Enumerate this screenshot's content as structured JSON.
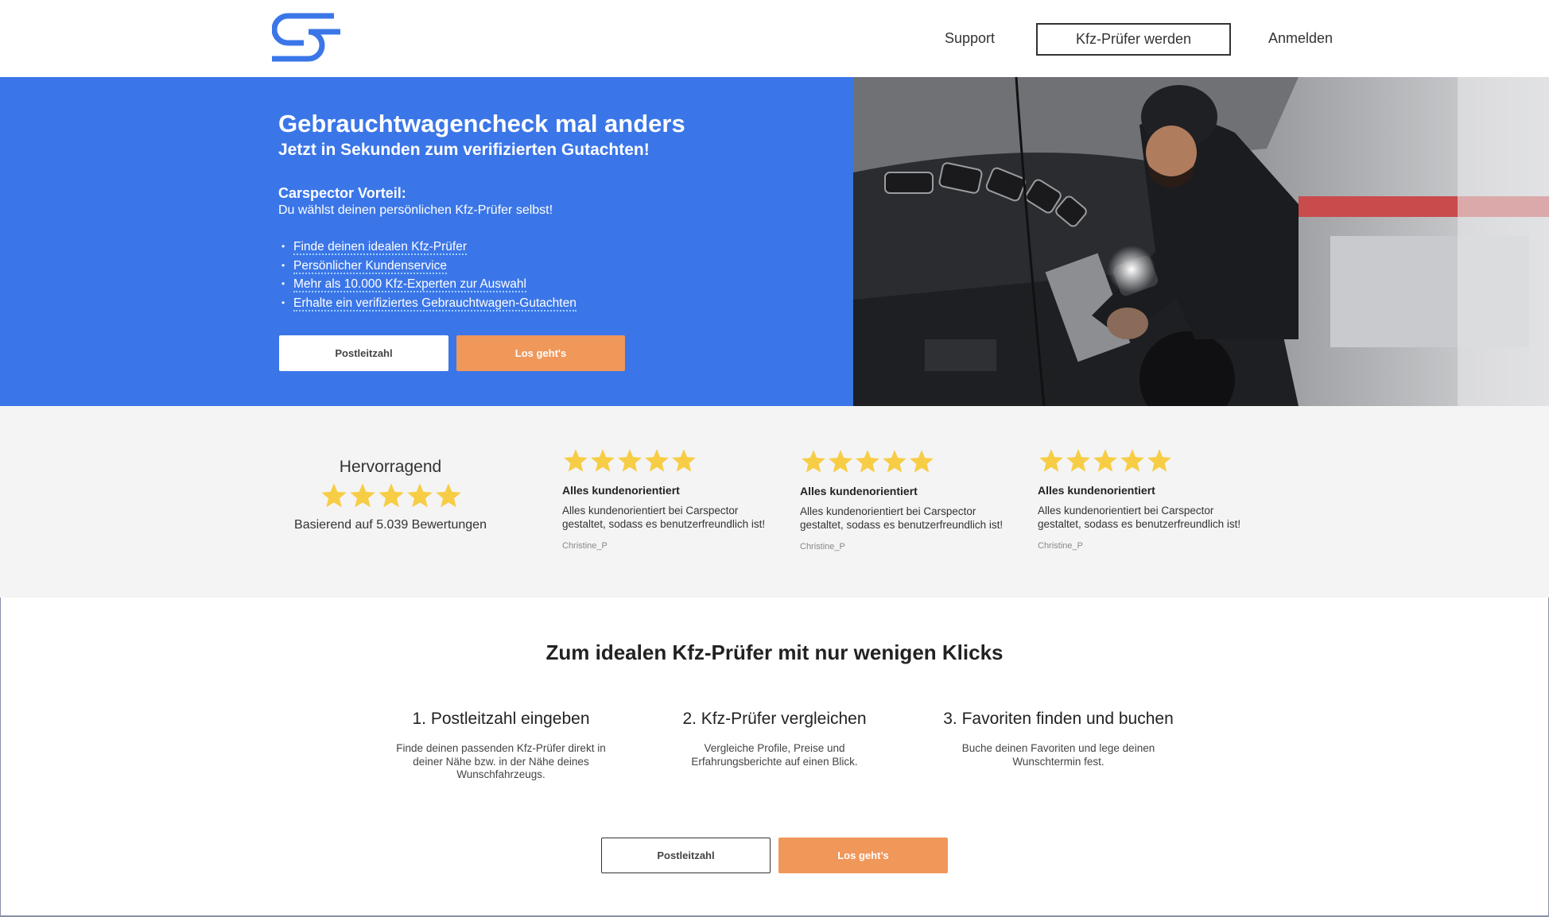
{
  "header": {
    "nav": {
      "support": "Support",
      "become_inspector": "Kfz-Prüfer werden",
      "login": "Anmelden"
    }
  },
  "hero": {
    "title": "Gebrauchtwagencheck mal anders",
    "subtitle": "Jetzt in Sekunden zum verifizierten Gutachten!",
    "advantage_heading": "Carspector Vorteil:",
    "advantage_text": "Du wählst deinen persönlichen Kfz-Prüfer selbst!",
    "bullets": [
      "Finde deinen idealen Kfz-Prüfer",
      "Persönlicher Kundenservice",
      "Mehr als 10.000 Kfz-Experten zur Auswahl",
      "Erhalte ein verifiziertes Gebrauchtwagen-Gutachten"
    ],
    "zip_button": "Postleitzahl",
    "go_button": "Los geht's"
  },
  "rating": {
    "label": "Hervorragend",
    "stars": 5,
    "count_text": "Basierend auf 5.039 Bewertungen"
  },
  "reviews": [
    {
      "stars": 5,
      "title": "Alles kundenorientiert",
      "text_line1": "Alles kundenorientiert bei Carspector",
      "text_line2": "gestaltet, sodass es benutzerfreundlich ist!",
      "author": "Christine_P"
    },
    {
      "stars": 5,
      "title": "Alles kundenorientiert",
      "text_line1": "Alles kundenorientiert bei Carspector",
      "text_line2": "gestaltet, sodass es benutzerfreundlich ist!",
      "author": "Christine_P"
    },
    {
      "stars": 5,
      "title": "Alles kundenorientiert",
      "text_line1": "Alles kundenorientiert bei Carspector",
      "text_line2": "gestaltet, sodass es benutzerfreundlich ist!",
      "author": "Christine_P"
    }
  ],
  "steps": {
    "title": "Zum idealen Kfz-Prüfer mit nur wenigen Klicks",
    "items": [
      {
        "heading": "1. Postleitzahl eingeben",
        "line1": "Finde deinen passenden Kfz-Prüfer direkt in",
        "line2": "deiner Nähe bzw. in der Nähe deines",
        "line3": "Wunschfahrzeugs."
      },
      {
        "heading": "2. Kfz-Prüfer vergleichen",
        "line1": "Vergleiche Profile, Preise und",
        "line2": "Erfahrungsberichte auf einen Blick.",
        "line3": ""
      },
      {
        "heading": "3. Favoriten finden und buchen",
        "line1": "Buche deinen Favoriten und lege deinen",
        "line2": "Wunschtermin fest.",
        "line3": ""
      }
    ],
    "zip_button": "Postleitzahl",
    "go_button": "Los geht’s"
  },
  "colors": {
    "brand_blue": "#3b76e8",
    "accent_orange": "#f0975a",
    "star_yellow": "#f7cd46",
    "review_bg": "#f4f4f4"
  },
  "icons": {
    "logo": "carspector-cs-logo",
    "star": "star-icon"
  }
}
